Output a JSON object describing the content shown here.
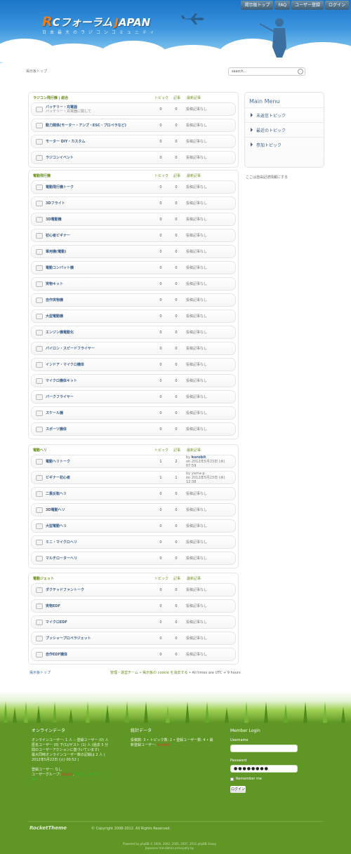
{
  "nav": {
    "items": [
      "掲示板トップ",
      "FAQ",
      "ユーザー登録",
      "ログイン"
    ]
  },
  "logo": {
    "r": "R",
    "c": "C",
    "forum": "フォーラム",
    "j": "J",
    "apan": "APAN",
    "tagline": "日本最大のラジコンコミュニティ"
  },
  "breadcrumb": "掲示板トップ",
  "search": {
    "placeholder": "search..."
  },
  "categories": [
    {
      "name": "ラジコン飛行機 | 総合",
      "topics_label": "トピック",
      "posts_label": "記事",
      "last_label": "最新記事",
      "forums": [
        {
          "name": "バッテリー・充電器",
          "desc": "バッテリー・充電器に関して",
          "topics": "0",
          "posts": "0",
          "last": "投稿記事なし"
        },
        {
          "name": "動力関係(モーター・アンプ・ESC・プロペラなど)",
          "desc": "",
          "topics": "0",
          "posts": "0",
          "last": "投稿記事なし"
        },
        {
          "name": "モーター DIY・カスタム",
          "desc": "",
          "topics": "0",
          "posts": "0",
          "last": "投稿記事なし"
        },
        {
          "name": "ラジコンイベント",
          "desc": "",
          "topics": "0",
          "posts": "0",
          "last": "投稿記事なし"
        }
      ]
    },
    {
      "name": "電動飛行機",
      "topics_label": "トピック",
      "posts_label": "記事",
      "last_label": "最新記事",
      "forums": [
        {
          "name": "電動飛行機トーク",
          "desc": "",
          "topics": "0",
          "posts": "0",
          "last": "投稿記事なし"
        },
        {
          "name": "3Dフライト",
          "desc": "",
          "topics": "0",
          "posts": "0",
          "last": "投稿記事なし"
        },
        {
          "name": "3D電動機",
          "desc": "",
          "topics": "0",
          "posts": "0",
          "last": "投稿記事なし"
        },
        {
          "name": "初心者ビギナー",
          "desc": "",
          "topics": "0",
          "posts": "0",
          "last": "投稿記事なし"
        },
        {
          "name": "軍用機(電動)",
          "desc": "",
          "topics": "0",
          "posts": "0",
          "last": "投稿記事なし"
        },
        {
          "name": "電動コンバット機",
          "desc": "",
          "topics": "0",
          "posts": "0",
          "last": "投稿記事なし"
        },
        {
          "name": "実物キット",
          "desc": "",
          "topics": "0",
          "posts": "0",
          "last": "投稿記事なし"
        },
        {
          "name": "自作実物機",
          "desc": "",
          "topics": "0",
          "posts": "0",
          "last": "投稿記事なし"
        },
        {
          "name": "大型電動機",
          "desc": "",
          "topics": "0",
          "posts": "0",
          "last": "投稿記事なし"
        },
        {
          "name": "エンジン機電動化",
          "desc": "",
          "topics": "0",
          "posts": "0",
          "last": "投稿記事なし"
        },
        {
          "name": "パイロン・スピードフライヤー",
          "desc": "",
          "topics": "0",
          "posts": "0",
          "last": "投稿記事なし"
        },
        {
          "name": "インドア・マイクロ機体",
          "desc": "",
          "topics": "0",
          "posts": "0",
          "last": "投稿記事なし"
        },
        {
          "name": "マイクロ機体キット",
          "desc": "",
          "topics": "0",
          "posts": "0",
          "last": "投稿記事なし"
        },
        {
          "name": "パークフライヤー",
          "desc": "",
          "topics": "0",
          "posts": "0",
          "last": "投稿記事なし"
        },
        {
          "name": "スケール機",
          "desc": "",
          "topics": "0",
          "posts": "0",
          "last": "投稿記事なし"
        },
        {
          "name": "スポーツ機体",
          "desc": "",
          "topics": "0",
          "posts": "0",
          "last": "投稿記事なし"
        }
      ]
    },
    {
      "name": "電動ヘリ",
      "topics_label": "トピック",
      "posts_label": "記事",
      "last_label": "最新記事",
      "forums": [
        {
          "name": "電動ヘリトーク",
          "desc": "",
          "topics": "1",
          "posts": "2",
          "last_by": "by",
          "last_user": "kurobit",
          "last": "on 2012年5月23日 (水) 07:59"
        },
        {
          "name": "ビギナー初心者",
          "desc": "",
          "topics": "1",
          "posts": "1",
          "last_by": "by",
          "last_user": "yama-p",
          "last": "on 2012年5月23日 (水) 12:38"
        },
        {
          "name": "二重反転ヘリ",
          "desc": "",
          "topics": "0",
          "posts": "0",
          "last": "投稿記事なし"
        },
        {
          "name": "3D電動ヘリ",
          "desc": "",
          "topics": "0",
          "posts": "0",
          "last": "投稿記事なし"
        },
        {
          "name": "大型電動ヘリ",
          "desc": "",
          "topics": "0",
          "posts": "0",
          "last": "投稿記事なし"
        },
        {
          "name": "ミニ・マイクロヘリ",
          "desc": "",
          "topics": "0",
          "posts": "0",
          "last": "投稿記事なし"
        },
        {
          "name": "マルチローターヘリ",
          "desc": "",
          "topics": "0",
          "posts": "0",
          "last": "投稿記事なし"
        }
      ]
    },
    {
      "name": "電動ジェット",
      "topics_label": "トピック",
      "posts_label": "記事",
      "last_label": "最新記事",
      "forums": [
        {
          "name": "ダクテッドファントーク",
          "desc": "",
          "topics": "0",
          "posts": "0",
          "last": "投稿記事なし"
        },
        {
          "name": "実物EDF",
          "desc": "",
          "topics": "0",
          "posts": "0",
          "last": "投稿記事なし"
        },
        {
          "name": "マイクロEDF",
          "desc": "",
          "topics": "0",
          "posts": "0",
          "last": "投稿記事なし"
        },
        {
          "name": "プッシャープロペラジェット",
          "desc": "",
          "topics": "0",
          "posts": "0",
          "last": "投稿記事なし"
        },
        {
          "name": "自作EDF機体",
          "desc": "",
          "topics": "0",
          "posts": "0",
          "last": "投稿記事なし"
        }
      ]
    }
  ],
  "mainmenu": {
    "title": "Main Menu",
    "items": [
      "未返信トピック",
      "最近のトピック",
      "参加トピック"
    ]
  },
  "sidebar_note": "ここは自由記述情報にする",
  "footer": {
    "crumb": "掲示板トップ",
    "links": "管理・運営チーム • 掲示板の cookie を消去する",
    "timezone": " • All times are UTC + 9 hours"
  },
  "online": {
    "title": "オンラインデータ",
    "text1": "オンラインユーザー: 1 人 :: 登録ユーザー (0) 人匿名ユーザー (0) 下(1)/ゲスト (1) 人 (過去 5 分間のユーザーアクションに基づいています)",
    "text2": "最大同時オンラインユーザー数の記録は 2 人 ( 2012年5月22日 (火) 00:52 )",
    "text3": "登録ユーザー: なし",
    "legend_label": "ユーザーグループ:",
    "admin": "Admin",
    "global_mod": "グローバルモデレーター"
  },
  "stats": {
    "title": "統計データ",
    "text": "投稿数: 3 • トピック数: 2 • 登録ユーザー数: 4 • 最新登録ユーザー:",
    "newest": "kurobit"
  },
  "login": {
    "title": "Member Login",
    "username_label": "Username",
    "username_value": "",
    "password_label": "Password",
    "password_value": "●●●●●●●●",
    "remember": "Remember me",
    "button": "ログイン"
  },
  "brand": "RocketTheme",
  "copyright": "© Copyright 2008-2012. All Rights Reserved.",
  "powered_by_1": "Powered by phpBB © 2000, 2002, 2005, 2007, 2012 phpBB Group",
  "powered_by_2": "Japanese translation principally by",
  "colors": {
    "header_blue": "#1b75c9",
    "grass_green": "#5f9625",
    "category_green": "#6b8f1f",
    "link_blue": "#3a5f8c",
    "logo_orange": "#f07c18"
  }
}
